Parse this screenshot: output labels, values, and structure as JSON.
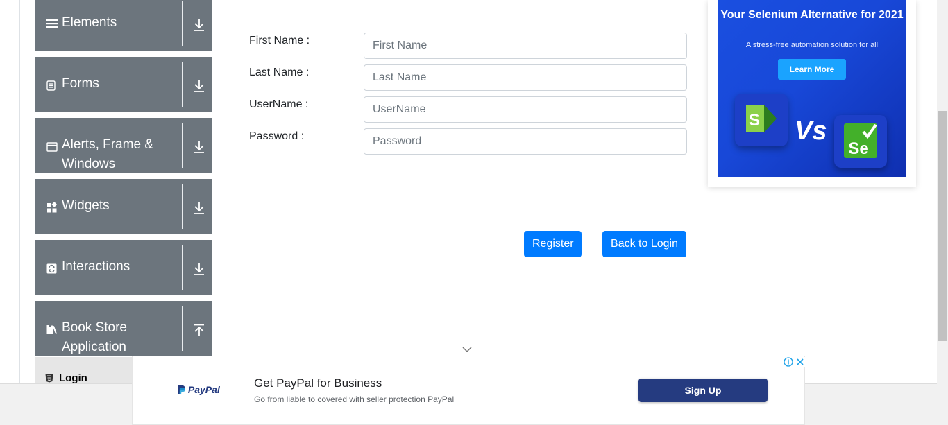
{
  "sidebar": {
    "groups": [
      {
        "label": "Elements",
        "icon": "menu-icon",
        "arrow": "download-arrow-icon"
      },
      {
        "label": "Forms",
        "icon": "document-icon",
        "arrow": "download-arrow-icon"
      },
      {
        "label": "Alerts, Frame & Windows",
        "icon": "window-icon",
        "arrow": "download-arrow-icon"
      },
      {
        "label": "Widgets",
        "icon": "widgets-icon",
        "arrow": "download-arrow-icon"
      },
      {
        "label": "Interactions",
        "icon": "interactions-icon",
        "arrow": "download-arrow-icon"
      },
      {
        "label": "Book Store Application",
        "icon": "books-icon",
        "arrow": "upload-arrow-icon"
      }
    ],
    "active_item": "Login"
  },
  "form": {
    "first_name": {
      "label": "First Name :",
      "placeholder": "First Name"
    },
    "last_name": {
      "label": "Last Name :",
      "placeholder": "Last Name"
    },
    "username": {
      "label": "UserName :",
      "placeholder": "UserName"
    },
    "password": {
      "label": "Password :",
      "placeholder": "Password"
    },
    "register_label": "Register",
    "back_label": "Back to Login"
  },
  "side_ad": {
    "title": "Your Selenium Alternative for 2021",
    "subtitle": "A stress-free automation solution for all",
    "cta": "Learn More",
    "vs": "Vs",
    "left_logo_letter": "S",
    "right_logo_letters": "Se"
  },
  "bottom_ad": {
    "brand": "PayPal",
    "title": "Get PayPal for Business",
    "subtitle": "Go from liable to covered with seller protection PayPal",
    "cta": "Sign Up"
  },
  "colors": {
    "sidebar_bg": "#6c757d",
    "primary": "#007bff",
    "paypal_navy": "#253b80"
  }
}
